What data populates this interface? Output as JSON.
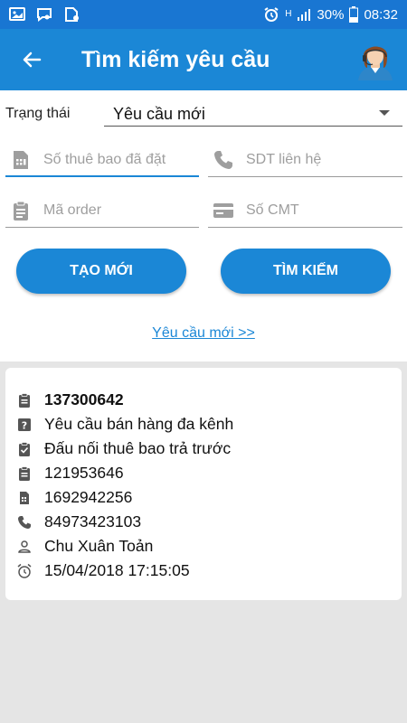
{
  "status_bar": {
    "network": "H",
    "battery": "30%",
    "time": "08:32"
  },
  "header": {
    "title": "Tìm kiếm yêu cầu"
  },
  "form": {
    "status_label": "Trạng thái",
    "status_value": "Yêu cầu mới",
    "subscriber_placeholder": "Số thuê bao đã đặt",
    "phone_placeholder": "SDT liên hệ",
    "order_placeholder": "Mã order",
    "id_placeholder": "Số CMT",
    "create_button": "TẠO MỚI",
    "search_button": "TÌM KIẾM",
    "new_request_link": "Yêu cầu mới >>"
  },
  "result": {
    "id": "137300642",
    "request_type": "Yêu cầu bán hàng đa kênh",
    "service": "Đấu nối thuê bao trả trước",
    "order": "121953646",
    "subscriber": "1692942256",
    "phone": "84973423103",
    "name": "Chu Xuân Toản",
    "datetime": "15/04/2018 17:15:05"
  },
  "colors": {
    "primary": "#1b87d6",
    "status_bar": "#1976d2",
    "background": "#e5e5e5"
  }
}
